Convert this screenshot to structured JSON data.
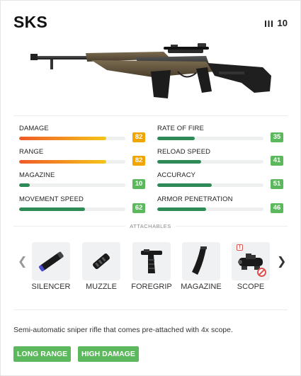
{
  "weapon": {
    "name": "SKS",
    "ammo_count": "10",
    "ammo_icon": "bullets-icon"
  },
  "stats_left": [
    {
      "label": "DAMAGE",
      "value": "82",
      "fraction": 0.82,
      "color": "#f0a500",
      "gradient": [
        "#f05a28",
        "#f5c518"
      ]
    },
    {
      "label": "RANGE",
      "value": "82",
      "fraction": 0.82,
      "color": "#f0a500",
      "gradient": [
        "#f05a28",
        "#f5c518"
      ]
    },
    {
      "label": "MAGAZINE",
      "value": "10",
      "fraction": 0.1,
      "color": "#5cb85c",
      "gradient": [
        "#2e8b57",
        "#2e8b57"
      ]
    },
    {
      "label": "MOVEMENT SPEED",
      "value": "62",
      "fraction": 0.62,
      "color": "#5cb85c",
      "gradient": [
        "#2e8b57",
        "#2e8b57"
      ]
    }
  ],
  "stats_right": [
    {
      "label": "RATE OF FIRE",
      "value": "35",
      "fraction": 0.35,
      "color": "#5cb85c",
      "gradient": [
        "#2e8b57",
        "#2e8b57"
      ]
    },
    {
      "label": "RELOAD SPEED",
      "value": "41",
      "fraction": 0.41,
      "color": "#5cb85c",
      "gradient": [
        "#2e8b57",
        "#2e8b57"
      ]
    },
    {
      "label": "ACCURACY",
      "value": "51",
      "fraction": 0.51,
      "color": "#5cb85c",
      "gradient": [
        "#2e8b57",
        "#2e8b57"
      ]
    },
    {
      "label": "ARMOR PENETRATION",
      "value": "46",
      "fraction": 0.46,
      "color": "#5cb85c",
      "gradient": [
        "#2e8b57",
        "#2e8b57"
      ]
    }
  ],
  "attachables": {
    "heading": "ATTACHABLES",
    "items": [
      {
        "label": "SILENCER",
        "icon": "silencer-icon"
      },
      {
        "label": "MUZZLE",
        "icon": "muzzle-icon"
      },
      {
        "label": "FOREGRIP",
        "icon": "foregrip-icon"
      },
      {
        "label": "MAGAZINE",
        "icon": "magazine-icon"
      },
      {
        "label": "SCOPE",
        "icon": "scope-icon",
        "badge": "!",
        "blocked": true
      }
    ],
    "prev_icon": "chevron-left-icon",
    "next_icon": "chevron-right-icon"
  },
  "description": "Semi-automatic sniper rifle that comes pre-attached with 4x scope.",
  "tags": [
    "LONG RANGE",
    "HIGH DAMAGE"
  ],
  "colors": {
    "tag": "#5cb85c",
    "badge_warn": "#d9534f"
  }
}
